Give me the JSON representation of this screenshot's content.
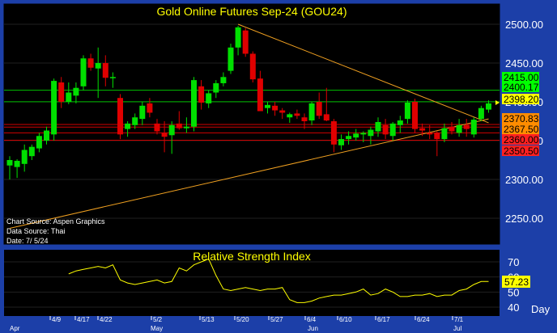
{
  "colors": {
    "background": "#000000",
    "frame": "#1c3fa8",
    "up": "#00e000",
    "down": "#e00000",
    "title": "#ffff00",
    "trendline": "#f0a020",
    "rsi": "#ffff00",
    "support_green": "#00c000",
    "resistance_red": "#d00000"
  },
  "price_panel": {
    "title": "Gold  Online  Futures  Sep-24  (GOU24)",
    "notes": [
      "Chart Source: Aspen Graphics",
      "Data Source: Thai",
      "Date: 7/ 5/24"
    ],
    "axis_labels": [
      "2500.00",
      "2450.00",
      "2400.00",
      "2350.00",
      "2300.00",
      "2250.00"
    ],
    "level_labels": [
      {
        "text": "2415.00",
        "value": 2415.0,
        "bg": "#00ff00"
      },
      {
        "text": "2400.17",
        "value": 2400.17,
        "bg": "#00ff00"
      },
      {
        "text": "2398.20",
        "value": 2398.2,
        "bg": "#ffff00"
      },
      {
        "text": "2370.83",
        "value": 2370.83,
        "bg": "#ff8c00"
      },
      {
        "text": "2367.50",
        "value": 2367.5,
        "bg": "#ff8c00"
      },
      {
        "text": "2360.00",
        "value": 2360.0,
        "bg": "#ff2020"
      },
      {
        "text": "2350.50",
        "value": 2350.5,
        "bg": "#ff2020"
      }
    ]
  },
  "rsi_panel": {
    "title": "Relative  Strength  Index",
    "axis_labels": [
      "70",
      "60",
      "50",
      "40"
    ],
    "current_label": "57.23"
  },
  "x_axis": {
    "day_label": "Day",
    "date_ticks": [
      "4/9",
      "4/17",
      "4/22",
      "5/2",
      "5/13",
      "5/20",
      "5/27",
      "6/4",
      "6/10",
      "6/17",
      "6/24",
      "7/1"
    ],
    "month_labels": [
      "Apr",
      "May",
      "Jun",
      "Jul"
    ]
  },
  "chart_data": [
    {
      "type": "candlestick",
      "title": "Gold  Online  Futures  Sep-24  (GOU24)",
      "ylim": [
        2235,
        2515
      ],
      "candles": [
        {
          "open": 2318,
          "high": 2330,
          "low": 2300,
          "close": 2325
        },
        {
          "open": 2316,
          "high": 2326,
          "low": 2302,
          "close": 2324
        },
        {
          "open": 2320,
          "high": 2345,
          "low": 2310,
          "close": 2338
        },
        {
          "open": 2330,
          "high": 2345,
          "low": 2325,
          "close": 2342
        },
        {
          "open": 2340,
          "high": 2360,
          "low": 2335,
          "close": 2356
        },
        {
          "open": 2350,
          "high": 2368,
          "low": 2345,
          "close": 2363
        },
        {
          "open": 2358,
          "high": 2430,
          "low": 2350,
          "close": 2427
        },
        {
          "open": 2425,
          "high": 2432,
          "low": 2392,
          "close": 2400
        },
        {
          "open": 2400,
          "high": 2425,
          "low": 2397,
          "close": 2412
        },
        {
          "open": 2408,
          "high": 2425,
          "low": 2398,
          "close": 2418
        },
        {
          "open": 2420,
          "high": 2460,
          "low": 2415,
          "close": 2456
        },
        {
          "open": 2456,
          "high": 2462,
          "low": 2440,
          "close": 2444
        },
        {
          "open": 2443,
          "high": 2470,
          "low": 2405,
          "close": 2450
        },
        {
          "open": 2450,
          "high": 2460,
          "low": 2420,
          "close": 2431
        },
        {
          "open": 2432,
          "high": 2438,
          "low": 2418,
          "close": 2432
        },
        {
          "open": 2405,
          "high": 2410,
          "low": 2352,
          "close": 2358
        },
        {
          "open": 2365,
          "high": 2375,
          "low": 2355,
          "close": 2372
        },
        {
          "open": 2370,
          "high": 2385,
          "low": 2365,
          "close": 2380
        },
        {
          "open": 2378,
          "high": 2400,
          "low": 2370,
          "close": 2395
        },
        {
          "open": 2398,
          "high": 2405,
          "low": 2380,
          "close": 2386
        },
        {
          "open": 2372,
          "high": 2378,
          "low": 2358,
          "close": 2362
        },
        {
          "open": 2360,
          "high": 2375,
          "low": 2335,
          "close": 2355
        },
        {
          "open": 2357,
          "high": 2375,
          "low": 2333,
          "close": 2370
        },
        {
          "open": 2372,
          "high": 2388,
          "low": 2364,
          "close": 2366
        },
        {
          "open": 2366,
          "high": 2380,
          "low": 2360,
          "close": 2368
        },
        {
          "open": 2368,
          "high": 2432,
          "low": 2362,
          "close": 2428
        },
        {
          "open": 2420,
          "high": 2428,
          "low": 2390,
          "close": 2399
        },
        {
          "open": 2398,
          "high": 2415,
          "low": 2392,
          "close": 2411
        },
        {
          "open": 2412,
          "high": 2428,
          "low": 2405,
          "close": 2424
        },
        {
          "open": 2424,
          "high": 2438,
          "low": 2420,
          "close": 2432
        },
        {
          "open": 2440,
          "high": 2475,
          "low": 2436,
          "close": 2470
        },
        {
          "open": 2470,
          "high": 2498,
          "low": 2460,
          "close": 2496
        },
        {
          "open": 2492,
          "high": 2495,
          "low": 2458,
          "close": 2462
        },
        {
          "open": 2462,
          "high": 2465,
          "low": 2425,
          "close": 2429
        },
        {
          "open": 2430,
          "high": 2440,
          "low": 2418,
          "close": 2388
        },
        {
          "open": 2392,
          "high": 2400,
          "low": 2385,
          "close": 2396
        },
        {
          "open": 2395,
          "high": 2400,
          "low": 2382,
          "close": 2389
        },
        {
          "open": 2389,
          "high": 2392,
          "low": 2378,
          "close": 2386
        },
        {
          "open": 2380,
          "high": 2386,
          "low": 2373,
          "close": 2384
        },
        {
          "open": 2385,
          "high": 2390,
          "low": 2378,
          "close": 2382
        },
        {
          "open": 2380,
          "high": 2385,
          "low": 2365,
          "close": 2375
        },
        {
          "open": 2376,
          "high": 2400,
          "low": 2370,
          "close": 2398
        },
        {
          "open": 2400,
          "high": 2412,
          "low": 2378,
          "close": 2382
        },
        {
          "open": 2384,
          "high": 2418,
          "low": 2375,
          "close": 2376
        },
        {
          "open": 2375,
          "high": 2378,
          "low": 2335,
          "close": 2345
        },
        {
          "open": 2344,
          "high": 2358,
          "low": 2338,
          "close": 2352
        },
        {
          "open": 2352,
          "high": 2362,
          "low": 2345,
          "close": 2356
        },
        {
          "open": 2354,
          "high": 2365,
          "low": 2350,
          "close": 2359
        },
        {
          "open": 2358,
          "high": 2362,
          "low": 2348,
          "close": 2360
        },
        {
          "open": 2356,
          "high": 2368,
          "low": 2345,
          "close": 2364
        },
        {
          "open": 2362,
          "high": 2380,
          "low": 2355,
          "close": 2374
        },
        {
          "open": 2370,
          "high": 2378,
          "low": 2352,
          "close": 2358
        },
        {
          "open": 2356,
          "high": 2374,
          "low": 2350,
          "close": 2372
        },
        {
          "open": 2370,
          "high": 2382,
          "low": 2360,
          "close": 2376
        },
        {
          "open": 2378,
          "high": 2402,
          "low": 2372,
          "close": 2399
        },
        {
          "open": 2400,
          "high": 2404,
          "low": 2360,
          "close": 2365
        },
        {
          "open": 2366,
          "high": 2372,
          "low": 2356,
          "close": 2363
        },
        {
          "open": 2360,
          "high": 2370,
          "low": 2352,
          "close": 2358
        },
        {
          "open": 2360,
          "high": 2362,
          "low": 2330,
          "close": 2352
        },
        {
          "open": 2352,
          "high": 2372,
          "low": 2348,
          "close": 2366
        },
        {
          "open": 2368,
          "high": 2374,
          "low": 2358,
          "close": 2362
        },
        {
          "open": 2360,
          "high": 2378,
          "low": 2355,
          "close": 2370
        },
        {
          "open": 2370,
          "high": 2378,
          "low": 2355,
          "close": 2365
        },
        {
          "open": 2358,
          "high": 2380,
          "low": 2354,
          "close": 2377
        },
        {
          "open": 2378,
          "high": 2395,
          "low": 2375,
          "close": 2392
        },
        {
          "open": 2390,
          "high": 2402,
          "low": 2386,
          "close": 2398
        }
      ],
      "horizontal_levels": [
        2415.0,
        2400.17,
        2370.83,
        2367.5,
        2360.0,
        2350.5
      ],
      "trendlines": [
        {
          "from": {
            "bar": 0,
            "value": 2237
          },
          "to": {
            "bar": 65,
            "value": 2378
          }
        },
        {
          "from": {
            "bar": 31,
            "value": 2500
          },
          "to": {
            "bar": 65,
            "value": 2373
          }
        }
      ]
    },
    {
      "type": "line",
      "title": "Relative  Strength  Index",
      "ylim": [
        35,
        75
      ],
      "series": [
        {
          "values": [
            62,
            64,
            65,
            66,
            67,
            66,
            68,
            58,
            56,
            55,
            56,
            57,
            58,
            56,
            57,
            66,
            64,
            68,
            70,
            72,
            61,
            52,
            51,
            52,
            53,
            52,
            51,
            52,
            52,
            53,
            45,
            43,
            43,
            44,
            46,
            47,
            48,
            48,
            49,
            50,
            52,
            48,
            49,
            52,
            50,
            47,
            47,
            48,
            48,
            49,
            47,
            48,
            48,
            51,
            52,
            55,
            57,
            57
          ]
        }
      ]
    }
  ]
}
